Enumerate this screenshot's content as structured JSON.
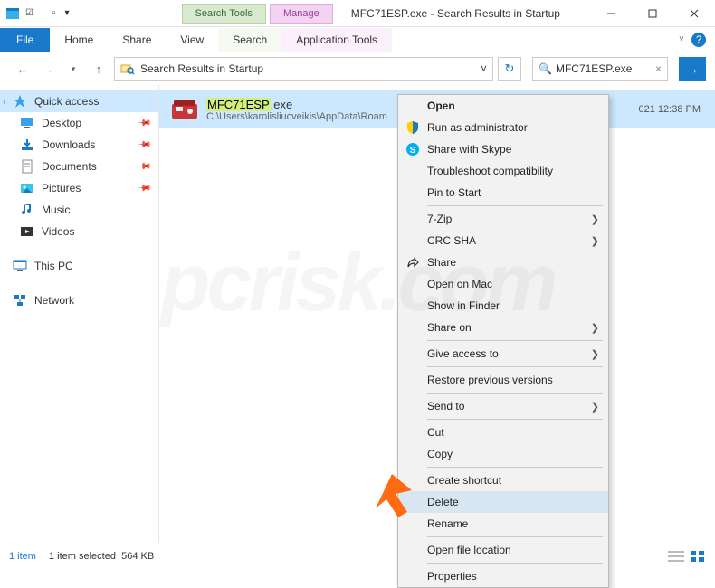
{
  "titlebar": {
    "tool_tab_search": "Search Tools",
    "tool_tab_manage": "Manage",
    "title": "MFC71ESP.exe - Search Results in Startup"
  },
  "ribbon": {
    "file": "File",
    "home": "Home",
    "share": "Share",
    "view": "View",
    "search": "Search",
    "app_tools": "Application Tools"
  },
  "address": {
    "location": "Search Results in Startup",
    "search_value": "MFC71ESP.exe"
  },
  "sidebar": {
    "quick_access": "Quick access",
    "desktop": "Desktop",
    "downloads": "Downloads",
    "documents": "Documents",
    "pictures": "Pictures",
    "music": "Music",
    "videos": "Videos",
    "this_pc": "This PC",
    "network": "Network"
  },
  "result": {
    "name_hl": "MFC71ESP",
    "name_ext": ".exe",
    "path": "C:\\Users\\karolisliucveikis\\AppData\\Roam",
    "date": "021 12:38 PM"
  },
  "context_menu": {
    "open": "Open",
    "run_admin": "Run as administrator",
    "share_skype": "Share with Skype",
    "troubleshoot": "Troubleshoot compatibility",
    "pin_start": "Pin to Start",
    "sevenzip": "7-Zip",
    "crc_sha": "CRC SHA",
    "share": "Share",
    "open_mac": "Open on Mac",
    "show_finder": "Show in Finder",
    "share_on": "Share on",
    "give_access": "Give access to",
    "restore_prev": "Restore previous versions",
    "send_to": "Send to",
    "cut": "Cut",
    "copy": "Copy",
    "create_shortcut": "Create shortcut",
    "delete": "Delete",
    "rename": "Rename",
    "open_file_loc": "Open file location",
    "properties": "Properties"
  },
  "statusbar": {
    "count": "1 item",
    "selected": "1 item selected",
    "size": "564 KB"
  },
  "watermark": "pcrisk.com"
}
